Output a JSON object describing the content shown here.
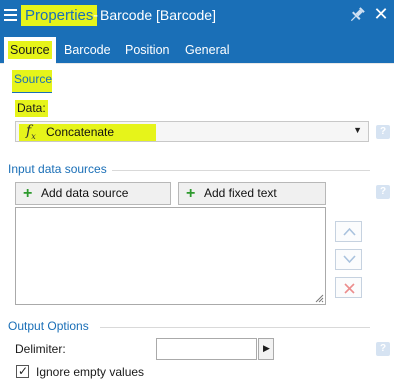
{
  "titlebar": {
    "panel_name": "Properties",
    "separator": "-",
    "object_title": "Barcode [Barcode]",
    "icons": {
      "menu": "hamburger-menu-icon",
      "pin": "pin-icon",
      "close": "close-icon"
    }
  },
  "tabs": [
    {
      "label": "Source",
      "active": true
    },
    {
      "label": "Barcode",
      "active": false
    },
    {
      "label": "Position",
      "active": false
    },
    {
      "label": "General",
      "active": false
    }
  ],
  "source_section": {
    "heading": "Source",
    "data_label": "Data:",
    "data_value": "Concatenate",
    "data_icon": "function-fx-icon"
  },
  "input_sources": {
    "heading": "Input data sources",
    "add_source_label": "Add data source",
    "add_text_label": "Add fixed text",
    "items": [],
    "side_buttons": [
      "move-up-icon",
      "move-down-icon",
      "delete-icon"
    ]
  },
  "output_options": {
    "heading": "Output Options",
    "delimiter_label": "Delimiter:",
    "delimiter_value": "",
    "ignore_empty_label": "Ignore empty values",
    "ignore_empty_checked": true
  },
  "help_glyph": "?",
  "colors": {
    "accent": "#1a6fb7",
    "highlight": "#e6f41a",
    "add_plus": "#2e9a2e",
    "delete": "#e04a4a"
  }
}
